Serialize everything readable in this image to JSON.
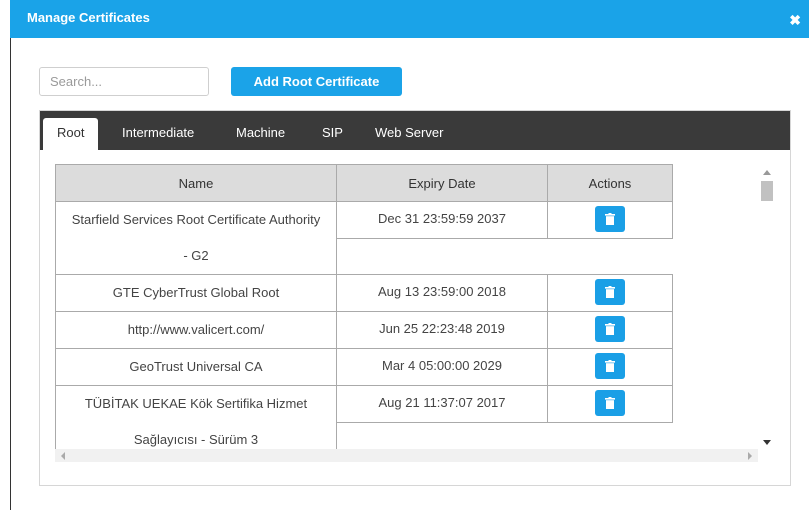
{
  "window": {
    "title": "Manage Certificates",
    "close_glyph": "✖"
  },
  "toolbar": {
    "search_placeholder": "Search...",
    "add_label": "Add Root Certificate"
  },
  "tabs": [
    {
      "label": "Root",
      "active": true
    },
    {
      "label": "Intermediate",
      "active": false
    },
    {
      "label": "Machine",
      "active": false
    },
    {
      "label": "SIP",
      "active": false
    },
    {
      "label": "Web Server",
      "active": false
    }
  ],
  "table": {
    "columns": [
      "Name",
      "Expiry Date",
      "Actions"
    ],
    "rows": [
      {
        "name_line1": "Starfield Services Root Certificate Authority",
        "name_line2": "- G2",
        "expiry": "Dec 31 23:59:59 2037"
      },
      {
        "name_line1": "GTE CyberTrust Global Root",
        "name_line2": "",
        "expiry": "Aug 13 23:59:00 2018"
      },
      {
        "name_line1": "http://www.valicert.com/",
        "name_line2": "",
        "expiry": "Jun 25 22:23:48 2019"
      },
      {
        "name_line1": "GeoTrust Universal CA",
        "name_line2": "",
        "expiry": "Mar 4 05:00:00 2029"
      },
      {
        "name_line1": "TÜBİTAK UEKAE Kök Sertifika Hizmet",
        "name_line2": "Sağlayıcısı - Sürüm 3",
        "expiry": "Aug 21 11:37:07 2017"
      }
    ]
  },
  "colors": {
    "accent": "#1aa3e8",
    "tabbar": "#3a3a3a",
    "header_bg": "#dcdcdc"
  }
}
